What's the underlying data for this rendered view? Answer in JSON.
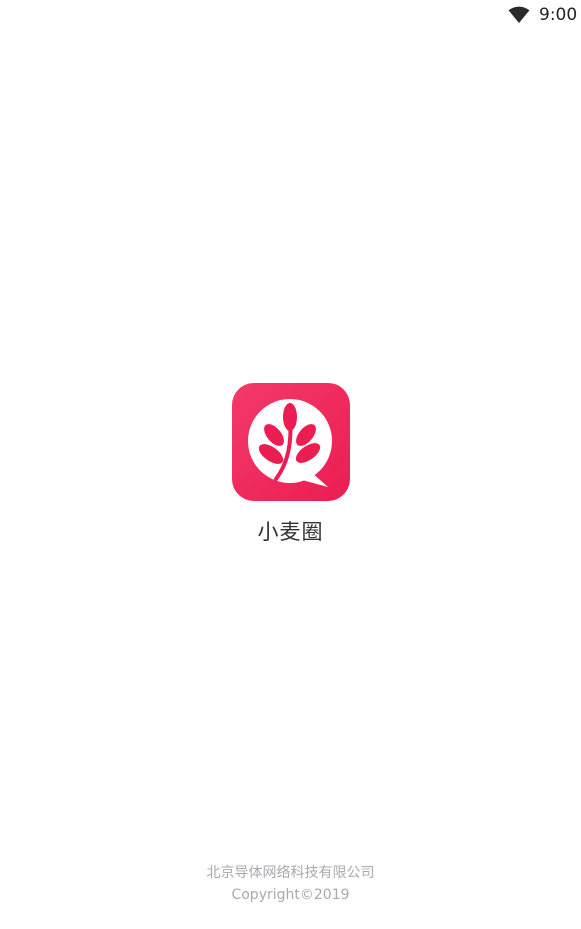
{
  "status_bar": {
    "time": "9:00",
    "wifi_icon": "wifi-icon"
  },
  "app": {
    "name": "小麦圈",
    "logo_icon": "wheat-chat-logo",
    "brand_color": "#f0245e"
  },
  "footer": {
    "company": "北京导体网络科技有限公司",
    "copyright": "Copyright©2019"
  }
}
